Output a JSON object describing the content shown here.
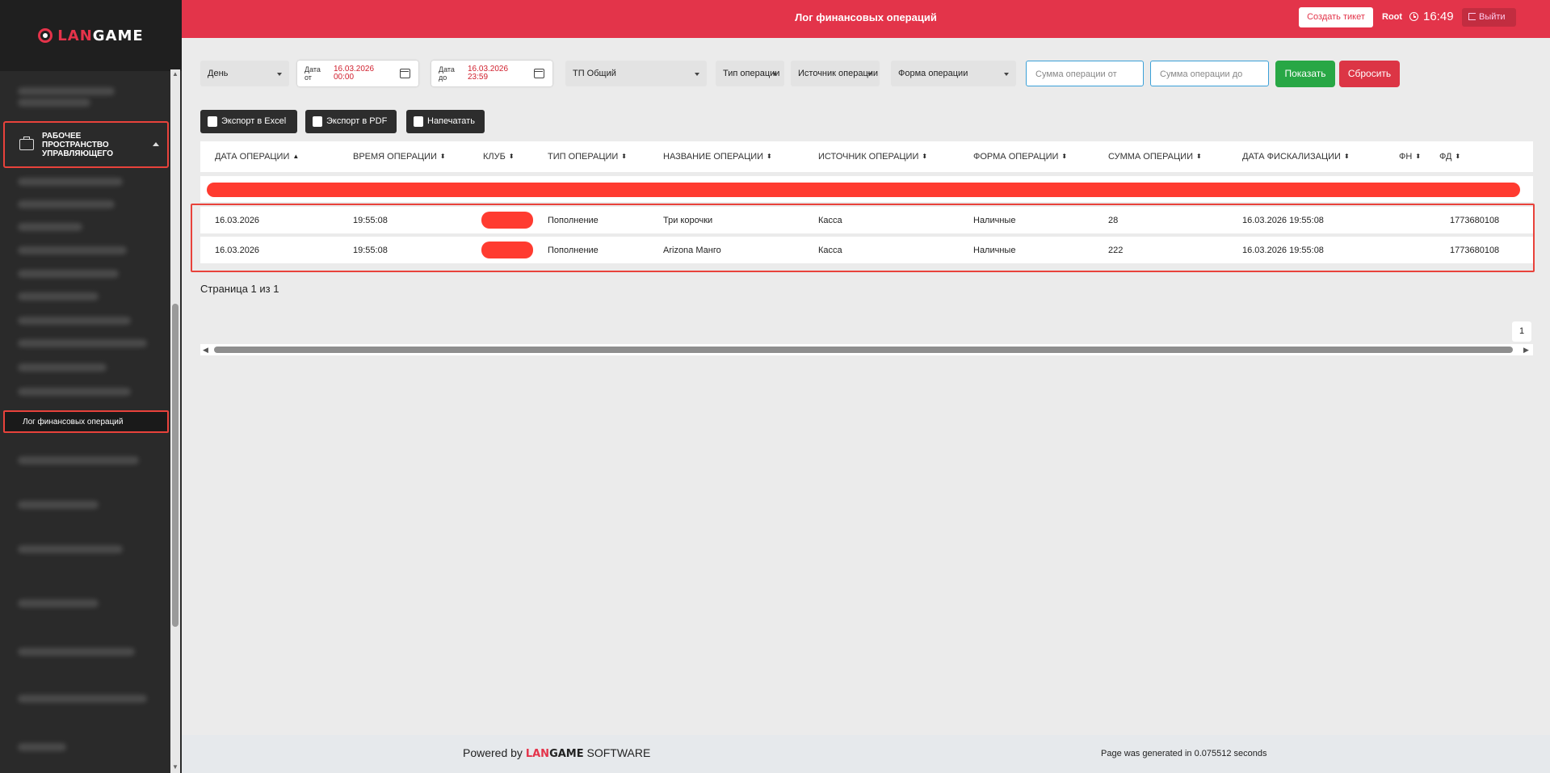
{
  "app": {
    "logo_text_a": "LAN",
    "logo_text_b": "GAME",
    "page_title": "Лог финансовых операций"
  },
  "header": {
    "create_ticket": "Создать тикет",
    "user": "Root",
    "time": "16:49",
    "logout": "Выйти"
  },
  "sidebar": {
    "workspace_label": "Рабочее пространство управляющего",
    "active_item": "Лог финансовых операций"
  },
  "filters": {
    "period": "День",
    "date_from_label": "Дата от",
    "date_from_value": "16.03.2026 00:00",
    "date_to_label": "Дата до",
    "date_to_value": "16.03.2026 23:59",
    "tp": "ТП Общий",
    "op_type": "Тип операции",
    "op_source": "Источник операции",
    "op_form": "Форма операции",
    "sum_from_placeholder": "Сумма операции от",
    "sum_to_placeholder": "Сумма операции до",
    "show_button": "Показать",
    "reset_button": "Сбросить"
  },
  "exports": {
    "excel": "Экспорт в Excel",
    "pdf": "Экспорт в PDF",
    "print": "Напечатать"
  },
  "table": {
    "columns": [
      "Дата операции",
      "Время операции",
      "Клуб",
      "Тип операции",
      "Название операции",
      "Источник операции",
      "Форма операции",
      "Сумма операции",
      "Дата фискализации",
      "ФН",
      "ФД"
    ],
    "rows": [
      {
        "date": "16.03.2026",
        "time": "19:55:08",
        "type": "Пополнение",
        "name": "Три корочки",
        "source": "Касса",
        "form": "Наличные",
        "sum": "28",
        "fiscal_date": "16.03.2026 19:55:08",
        "fd": "1773680108"
      },
      {
        "date": "16.03.2026",
        "time": "19:55:08",
        "type": "Пополнение",
        "name": "Arizona Манго",
        "source": "Касса",
        "form": "Наличные",
        "sum": "222",
        "fiscal_date": "16.03.2026 19:55:08",
        "fd": "1773680108"
      }
    ]
  },
  "pagination": {
    "text": "Страница 1 из 1",
    "page": "1"
  },
  "footer": {
    "powered_by": "Powered by",
    "brand_a": "LAN",
    "brand_b": "GAME",
    "software": "SOFTWARE",
    "generated": "Page was generated in 0.075512 seconds"
  },
  "colors": {
    "brand_red": "#e3344a",
    "success": "#28a745",
    "danger": "#dc3545",
    "sidebar": "#2a2a2a"
  }
}
